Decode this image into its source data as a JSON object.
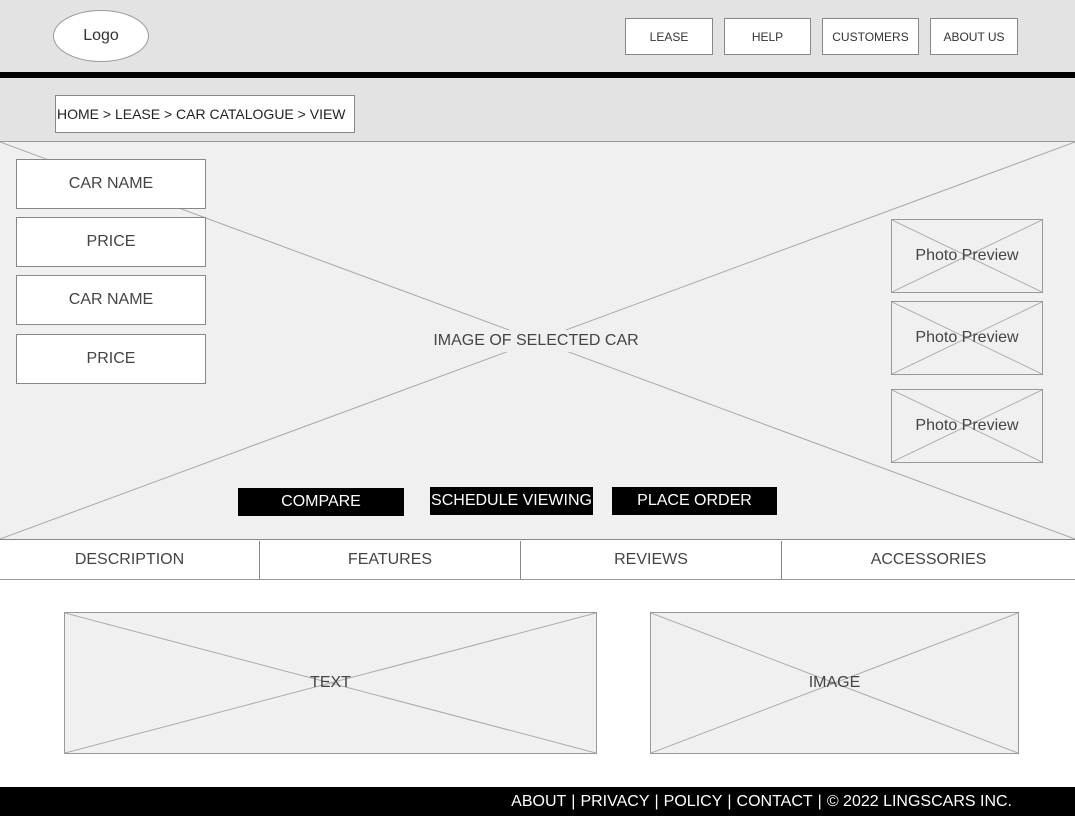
{
  "header": {
    "logo": "Logo",
    "nav": [
      {
        "label": "LEASE"
      },
      {
        "label": "HELP"
      },
      {
        "label": "CUSTOMERS"
      },
      {
        "label": "ABOUT US"
      }
    ]
  },
  "breadcrumb": "HOME > LEASE > CAR CATALOGUE > VIEW",
  "sidebar": [
    {
      "label": "CAR NAME"
    },
    {
      "label": "PRICE"
    },
    {
      "label": "CAR NAME"
    },
    {
      "label": "PRICE"
    }
  ],
  "hero": {
    "image_label": "IMAGE OF SELECTED CAR",
    "previews": [
      {
        "label": "Photo Preview"
      },
      {
        "label": "Photo Preview"
      },
      {
        "label": "Photo Preview"
      }
    ],
    "actions": {
      "compare": "COMPARE",
      "schedule": "SCHEDULE VIEWING",
      "order": "PLACE ORDER"
    }
  },
  "tabs": [
    {
      "label": "DESCRIPTION"
    },
    {
      "label": "FEATURES"
    },
    {
      "label": "REVIEWS"
    },
    {
      "label": "ACCESSORIES"
    }
  ],
  "content": {
    "text_label": "TEXT",
    "image_label": "IMAGE"
  },
  "footer": {
    "about": "ABOUT",
    "privacy": "PRIVACY",
    "policy": "POLICY",
    "contact": "CONTACT",
    "separator": "|",
    "copyright": "© 2022 LINGSCARS INC."
  }
}
